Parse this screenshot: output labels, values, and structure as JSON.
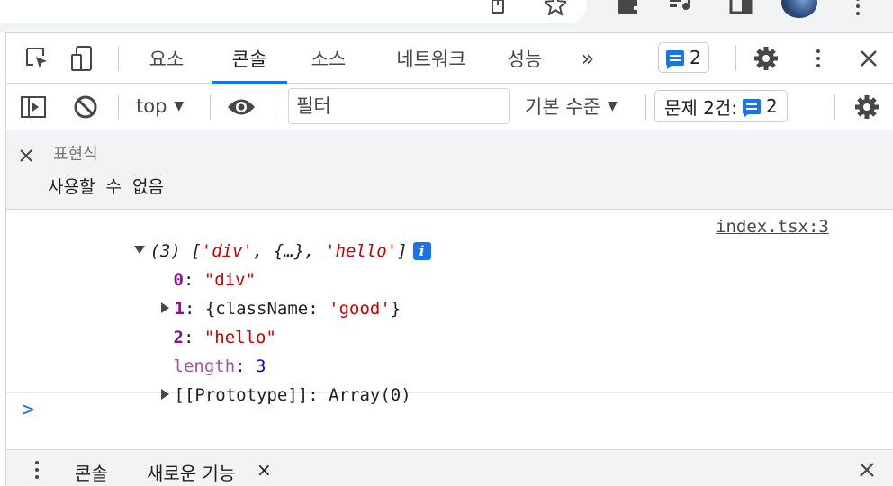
{
  "devtools": {
    "tabs": [
      {
        "label": "요소",
        "active": false
      },
      {
        "label": "콘솔",
        "active": true
      },
      {
        "label": "소스",
        "active": false
      },
      {
        "label": "네트워크",
        "active": false
      },
      {
        "label": "성능",
        "active": false
      }
    ],
    "more_tabs_label": "»",
    "issues_badge_count": "2"
  },
  "toolbar": {
    "context": "top",
    "filter_placeholder": "필터",
    "level": "기본 수준",
    "issues_label": "문제 2건:",
    "issues_count": "2"
  },
  "live_expression": {
    "title": "표현식",
    "value": "사용할 수 없음"
  },
  "console_log": {
    "summary_count": "(3)",
    "summary_open": "[",
    "summary_item1": "'div'",
    "summary_sep1": ", ",
    "summary_item2": "{…}",
    "summary_sep2": ", ",
    "summary_item3": "'hello'",
    "summary_close": "]",
    "info_glyph": "i",
    "source": "index.tsx:3",
    "entries": [
      {
        "key": "0",
        "colon": ": ",
        "value": "\"div\""
      },
      {
        "key": "1",
        "colon": ": ",
        "value_open": "{className: ",
        "value_str": "'good'",
        "value_close": "}"
      },
      {
        "key": "2",
        "colon": ": ",
        "value": "\"hello\""
      },
      {
        "key": "length",
        "colon": ": ",
        "value": "3"
      },
      {
        "key": "[[Prototype]]",
        "colon": ": ",
        "value": "Array(0)"
      }
    ],
    "prompt": ">"
  },
  "drawer": {
    "tabs": [
      {
        "label": "콘솔"
      },
      {
        "label": "새로운 기능"
      }
    ],
    "tab_close": "×"
  },
  "colors": {
    "accent": "#1a73e8",
    "string": "#c80000",
    "key": "#881391",
    "number": "#1c00cf"
  }
}
